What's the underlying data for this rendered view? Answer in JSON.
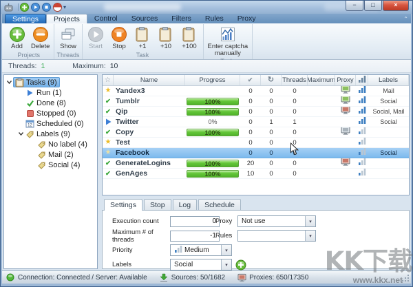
{
  "window": {
    "title": ""
  },
  "qat": {
    "icons": [
      "qat-add",
      "qat-run",
      "qat-stop",
      "qat-flag"
    ]
  },
  "win_controls": [
    {
      "name": "minimize",
      "glyph": "−"
    },
    {
      "name": "maximize",
      "glyph": "□"
    },
    {
      "name": "close",
      "glyph": "×"
    }
  ],
  "ribbon": {
    "tabs": [
      {
        "label": "Settings",
        "style": "settings"
      },
      {
        "label": "Projects",
        "active": true
      },
      {
        "label": "Control"
      },
      {
        "label": "Sources"
      },
      {
        "label": "Filters"
      },
      {
        "label": "Rules"
      },
      {
        "label": "Proxy"
      }
    ],
    "groups": [
      {
        "caption": "Projects",
        "buttons": [
          {
            "label": "Add",
            "icon": "add"
          },
          {
            "label": "Delete",
            "icon": "delete"
          }
        ]
      },
      {
        "caption": "Threads",
        "buttons": [
          {
            "label": "Show",
            "icon": "show"
          }
        ]
      },
      {
        "caption": "Task",
        "buttons": [
          {
            "label": "Start",
            "icon": "start",
            "disabled": true
          },
          {
            "label": "Stop",
            "icon": "stop"
          },
          {
            "label": "+1",
            "icon": "clipboard"
          },
          {
            "label": "+10",
            "icon": "clipboard"
          },
          {
            "label": "+100",
            "icon": "clipboard"
          }
        ]
      },
      {
        "caption": "Tools",
        "buttons": [
          {
            "label": "Enter captcha\nmanually",
            "icon": "captcha"
          }
        ]
      }
    ]
  },
  "threadbar": {
    "threads_label": "Threads:",
    "threads_value": "1",
    "maximum_label": "Maximum:",
    "maximum_value": "10"
  },
  "tree": {
    "items": [
      {
        "label": "Tasks (9)",
        "icon": "tasks",
        "depth": 0,
        "chevron": true,
        "selected": true
      },
      {
        "label": "Run (1)",
        "icon": "run",
        "depth": 1
      },
      {
        "label": "Done (8)",
        "icon": "done",
        "depth": 1
      },
      {
        "label": "Stopped (0)",
        "icon": "stopped",
        "depth": 1
      },
      {
        "label": "Scheduled (0)",
        "icon": "scheduled",
        "depth": 1
      },
      {
        "label": "Labels (9)",
        "icon": "tag",
        "depth": 1,
        "chevron": true
      },
      {
        "label": "No label (4)",
        "icon": "tag",
        "depth": 2
      },
      {
        "label": "Mail (2)",
        "icon": "tag",
        "depth": 2
      },
      {
        "label": "Social (4)",
        "icon": "tag",
        "depth": 2
      }
    ]
  },
  "table": {
    "columns": [
      {
        "key": "state",
        "icon": "hdr-star"
      },
      {
        "key": "name",
        "label": "Name"
      },
      {
        "key": "progress",
        "label": "Progress"
      },
      {
        "key": "done",
        "icon": "hdr-check"
      },
      {
        "key": "retry",
        "icon": "hdr-refresh"
      },
      {
        "key": "threads",
        "label": "Threads"
      },
      {
        "key": "maximum",
        "label": "Maximum"
      },
      {
        "key": "proxy",
        "label": "Proxy"
      },
      {
        "key": "priority",
        "icon": "hdr-bars"
      },
      {
        "key": "labels",
        "label": "Labels"
      }
    ],
    "rows": [
      {
        "state": "star",
        "name": "Yandex3",
        "progress": null,
        "done": "0",
        "retry": "0",
        "threads": "0",
        "maximum": "",
        "proxy": "green",
        "priority": "high",
        "labels": "Mail"
      },
      {
        "state": "check",
        "name": "Tumblr",
        "progress": {
          "text": "100%",
          "bar": true
        },
        "done": "0",
        "retry": "0",
        "threads": "0",
        "maximum": "",
        "proxy": "green",
        "priority": "high",
        "labels": "Social"
      },
      {
        "state": "check",
        "name": "Qip",
        "progress": {
          "text": "100%",
          "bar": true
        },
        "done": "0",
        "retry": "0",
        "threads": "0",
        "maximum": "",
        "proxy": "red",
        "priority": "high",
        "labels": "Social, Mail"
      },
      {
        "state": "play",
        "name": "Twitter",
        "progress": {
          "text": "0%",
          "bar": false
        },
        "done": "0",
        "retry": "1",
        "threads": "1",
        "maximum": "",
        "proxy": null,
        "priority": "high",
        "labels": "Social"
      },
      {
        "state": "check",
        "name": "Copy",
        "progress": {
          "text": "100%",
          "bar": true
        },
        "done": "0",
        "retry": "0",
        "threads": "0",
        "maximum": "",
        "proxy": "gray",
        "priority": "low",
        "labels": ""
      },
      {
        "state": "star",
        "name": "Test",
        "progress": null,
        "done": "0",
        "retry": "0",
        "threads": "0",
        "maximum": "",
        "proxy": null,
        "priority": "low",
        "labels": ""
      },
      {
        "state": "star-pale",
        "name": "Facebook",
        "progress": null,
        "done": "0",
        "retry": "0",
        "threads": "0",
        "maximum": "",
        "proxy": null,
        "priority": "low",
        "labels": "Social",
        "selected": true
      },
      {
        "state": "check",
        "name": "GenerateLogins",
        "progress": {
          "text": "100%",
          "bar": true
        },
        "done": "20",
        "retry": "0",
        "threads": "0",
        "maximum": "",
        "proxy": "red",
        "priority": "low",
        "labels": ""
      },
      {
        "state": "check",
        "name": "GenAges",
        "progress": {
          "text": "100%",
          "bar": true
        },
        "done": "10",
        "retry": "0",
        "threads": "0",
        "maximum": "",
        "proxy": null,
        "priority": "low",
        "labels": ""
      }
    ]
  },
  "bottom": {
    "tabs": [
      {
        "label": "Settings",
        "active": true
      },
      {
        "label": "Stop"
      },
      {
        "label": "Log"
      },
      {
        "label": "Schedule"
      }
    ],
    "fields_left": [
      {
        "label": "Execution count",
        "type": "input",
        "value": "0"
      },
      {
        "label": "Maximum # of threads",
        "type": "input",
        "value": "-1"
      },
      {
        "label": "Priority",
        "type": "dropdown",
        "value": "Medium",
        "icon": "bars-low"
      },
      {
        "label": "Labels",
        "type": "dropdown",
        "value": "Social",
        "add_button": true
      }
    ],
    "fields_right": [
      {
        "label": "Proxy",
        "type": "dropdown",
        "value": "Not use"
      },
      {
        "label": "Rules",
        "type": "dropdown",
        "value": ""
      }
    ]
  },
  "statusbar": {
    "items": [
      {
        "icon": "status-dot",
        "text": "Connection: Connected / Server: Available"
      },
      {
        "icon": "sources-arrow",
        "text": "Sources: 50/1682"
      },
      {
        "icon": "proxy-computer",
        "text": "Proxies: 650/17350"
      }
    ]
  },
  "watermark": {
    "big": "KK下载",
    "small": "www.kkx.net"
  }
}
